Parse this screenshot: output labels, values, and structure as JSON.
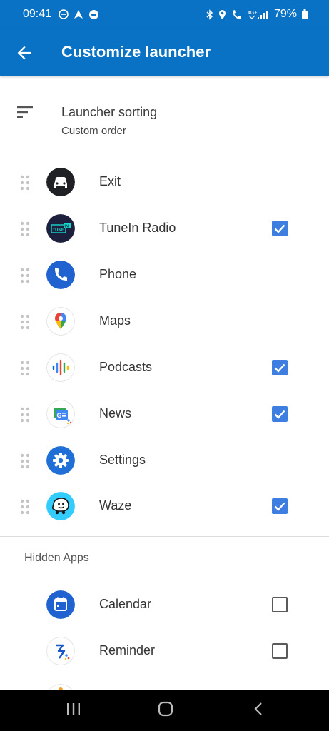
{
  "status": {
    "time": "09:41",
    "battery": "79%"
  },
  "header": {
    "title": "Customize launcher"
  },
  "sorting": {
    "title": "Launcher sorting",
    "value": "Custom order"
  },
  "apps": [
    {
      "label": "Exit",
      "icon": "car-exit-icon",
      "checked": null
    },
    {
      "label": "TuneIn Radio",
      "icon": "tunein-icon",
      "checked": true
    },
    {
      "label": "Phone",
      "icon": "phone-icon",
      "checked": null
    },
    {
      "label": "Maps",
      "icon": "maps-pin-icon",
      "checked": null
    },
    {
      "label": "Podcasts",
      "icon": "podcasts-icon",
      "checked": true
    },
    {
      "label": "News",
      "icon": "news-icon",
      "checked": true
    },
    {
      "label": "Settings",
      "icon": "gear-icon",
      "checked": null
    },
    {
      "label": "Waze",
      "icon": "waze-icon",
      "checked": true
    }
  ],
  "hidden": {
    "heading": "Hidden Apps",
    "apps": [
      {
        "label": "Calendar",
        "icon": "calendar-icon",
        "checked": false
      },
      {
        "label": "Reminder",
        "icon": "reminder-icon",
        "checked": false
      }
    ]
  },
  "colors": {
    "accent": "#0a72c4",
    "checkbox": "#3e7ee0"
  }
}
